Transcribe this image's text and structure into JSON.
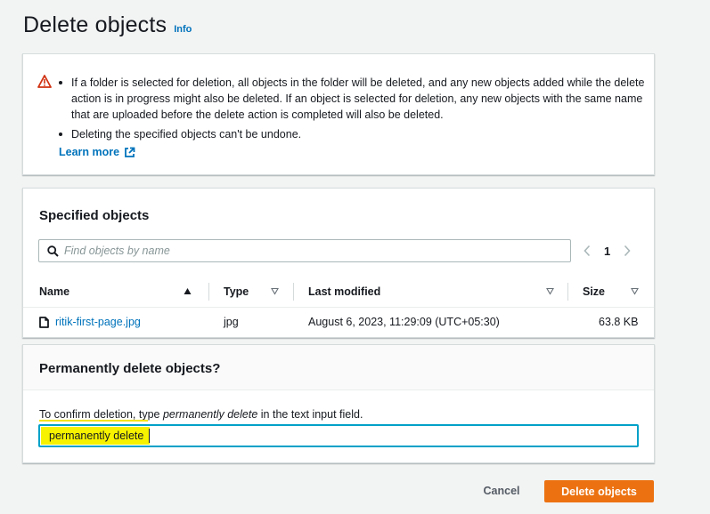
{
  "header": {
    "title": "Delete objects",
    "info": "Info"
  },
  "warning": {
    "items": [
      "If a folder is selected for deletion, all objects in the folder will be deleted, and any new objects added while the delete action is in progress might also be deleted. If an object is selected for deletion, any new objects with the same name that are uploaded before the delete action is completed will also be deleted.",
      "Deleting the specified objects can't be undone."
    ],
    "learn_more": "Learn more"
  },
  "specified": {
    "title": "Specified objects",
    "search_placeholder": "Find objects by name",
    "page": "1",
    "columns": {
      "name": "Name",
      "type": "Type",
      "last_modified": "Last modified",
      "size": "Size"
    },
    "rows": [
      {
        "name": "ritik-first-page.jpg",
        "type": "jpg",
        "last_modified": "August 6, 2023, 11:29:09 (UTC+05:30)",
        "size": "63.8 KB"
      }
    ]
  },
  "confirm": {
    "title": "Permanently delete objects?",
    "instr_prefix": "To confirm deletion, type ",
    "instr_phrase": "permanently delete",
    "instr_suffix": " in the text input field.",
    "value": "permanently delete"
  },
  "actions": {
    "cancel": "Cancel",
    "delete": "Delete objects"
  },
  "colors": {
    "accent": "#0073bb",
    "warning": "#d13212",
    "primary": "#ec7211",
    "highlight": "#f6f200"
  }
}
